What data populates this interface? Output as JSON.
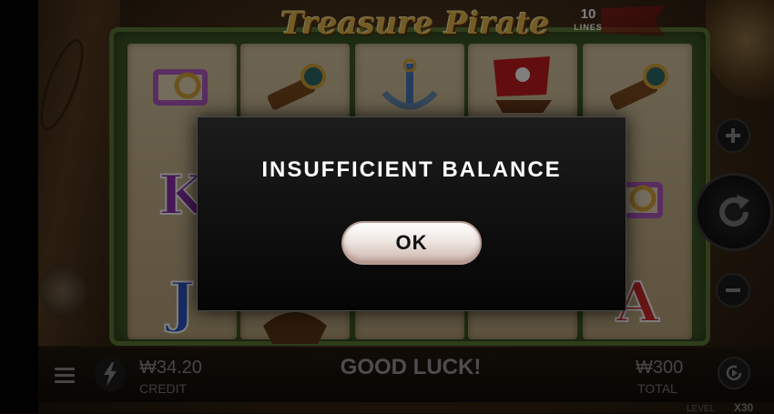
{
  "game": {
    "title": "Treasure Pirate",
    "lines_count": "10",
    "lines_label": "LINES"
  },
  "reels": [
    {
      "top": "scroll-map",
      "mid": "K",
      "bottom": "J"
    },
    {
      "top": "spyglass",
      "mid": "",
      "bottom": "ship-bow"
    },
    {
      "top": "anchor",
      "mid": "",
      "bottom": ""
    },
    {
      "top": "pirate-ship",
      "mid": "",
      "bottom": ""
    },
    {
      "top": "spyglass",
      "mid": "scroll-map",
      "bottom": "A"
    }
  ],
  "controls": {
    "bet_up_icon": "plus-icon",
    "spin_icon": "refresh-icon",
    "bet_down_icon": "minus-icon"
  },
  "bottom_bar": {
    "credit_value": "₩34.20",
    "credit_label": "CREDIT",
    "message": "GOOD LUCK!",
    "total_value": "₩300",
    "total_label": "TOTAL",
    "level_label": "LEVEL",
    "level_value": "X30"
  },
  "modal": {
    "title": "INSUFFICIENT BALANCE",
    "ok_label": "OK"
  },
  "colors": {
    "logo_gold": "#e6b94a",
    "letter_k": "#8e2fae",
    "letter_j": "#2f56c9",
    "letter_a": "#d2292b"
  }
}
